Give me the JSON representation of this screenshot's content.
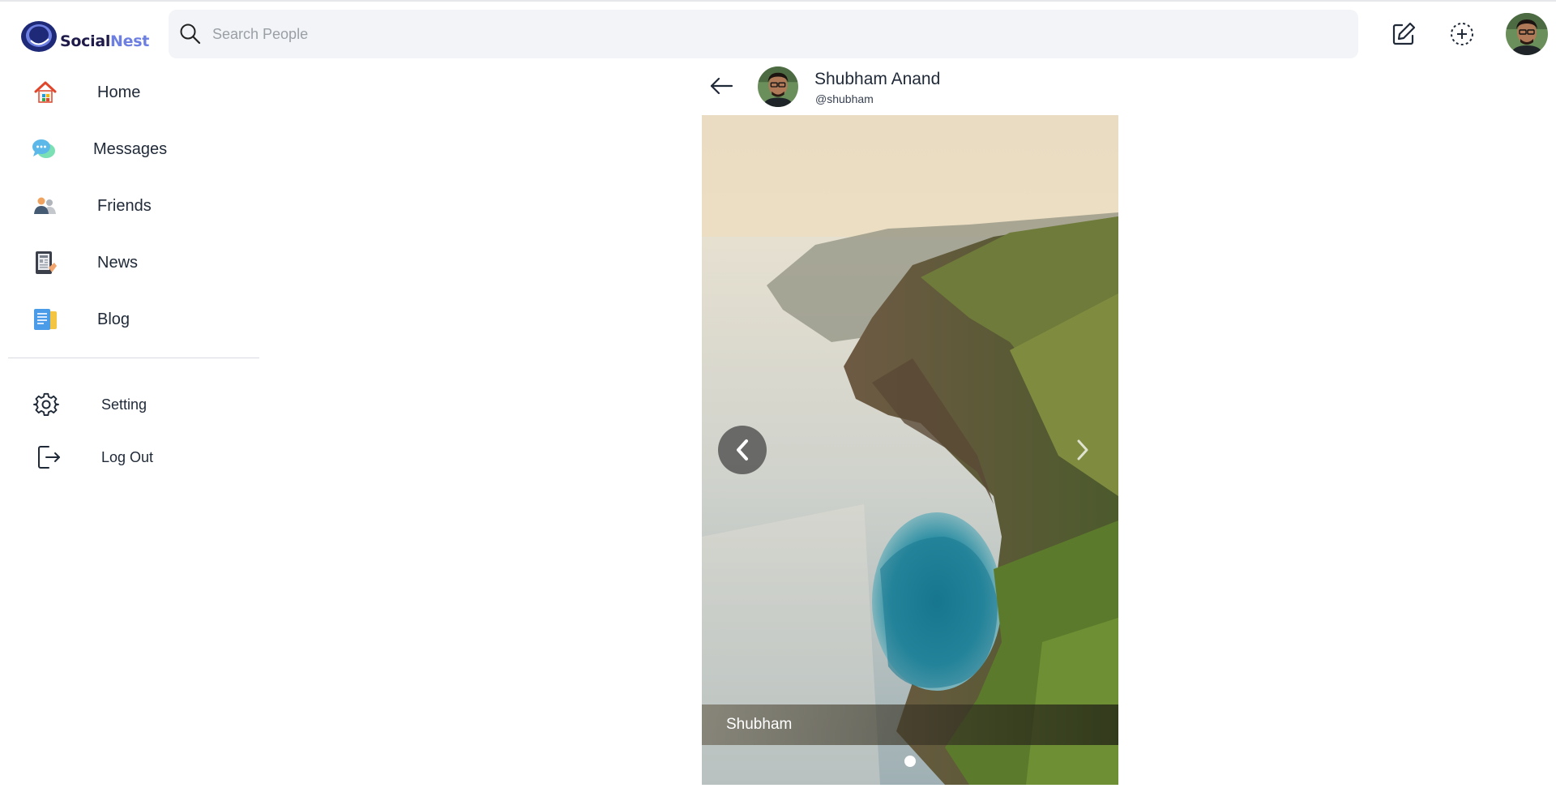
{
  "brand": {
    "part1": "Social",
    "part2": "Nest"
  },
  "search": {
    "placeholder": "Search People"
  },
  "sidebar": {
    "items": [
      {
        "label": "Home",
        "icon": "home-icon"
      },
      {
        "label": "Messages",
        "icon": "chat-bubbles-icon"
      },
      {
        "label": "Friends",
        "icon": "people-icon"
      },
      {
        "label": "News",
        "icon": "news-tablet-icon"
      },
      {
        "label": "Blog",
        "icon": "blog-document-icon"
      }
    ],
    "bottom": [
      {
        "label": "Setting",
        "icon": "gear-icon"
      },
      {
        "label": "Log Out",
        "icon": "logout-icon"
      }
    ]
  },
  "post": {
    "name": "Shubham Anand",
    "handle": "@shubham",
    "caption": "Shubham"
  },
  "colors": {
    "accent": "#6d7fe0",
    "brand_dark": "#1e1b4b",
    "search_bg": "#f2f4f7"
  }
}
